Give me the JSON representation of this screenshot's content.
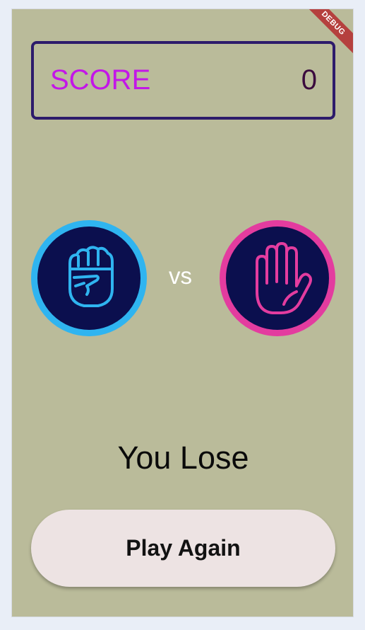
{
  "debug_banner": "DEBUG",
  "score": {
    "label": "SCORE",
    "value": "0",
    "label_color": "#c316e8",
    "border_color": "#2d1b6b"
  },
  "player_choice": {
    "icon": "rock-fist-icon",
    "ring_color": "#2fb4f0"
  },
  "vs_text": "vs",
  "computer_choice": {
    "icon": "paper-hand-icon",
    "ring_color": "#e33c9f"
  },
  "result_text": "You Lose",
  "play_again_label": "Play Again",
  "colors": {
    "background": "#babb9a",
    "circle_fill": "#0b0f4e",
    "button_fill": "#ede3e3"
  }
}
